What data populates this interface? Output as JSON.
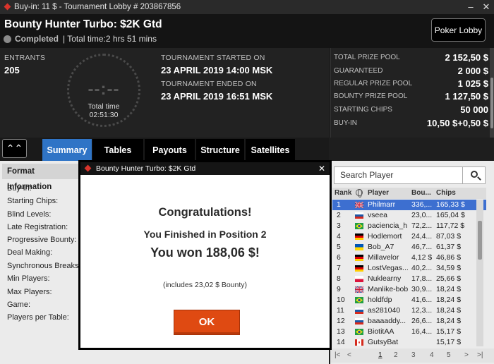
{
  "titlebar": {
    "title": "Buy-in: 11 $ - Tournament Lobby # 203867856",
    "minimize": "–",
    "close": "✕"
  },
  "header": {
    "name": "Bounty Hunter Turbo: $2K Gtd",
    "status": "Completed",
    "total_time": "| Total time:2 hrs  51 mins",
    "lobby_button": "Poker Lobby"
  },
  "info": {
    "entrants_label": "ENTRANTS",
    "entrants_value": "205",
    "clock_digits": "--:--",
    "clock_label": "Total time",
    "clock_time": "02:51:30",
    "started_label": "TOURNAMENT STARTED ON",
    "started_value": "23 APRIL 2019  14:00 MSK",
    "ended_label": "TOURNAMENT ENDED ON",
    "ended_value": "23 APRIL 2019  16:51 MSK"
  },
  "prize": [
    {
      "label": "TOTAL PRIZE POOL",
      "value": "2 152,50 $"
    },
    {
      "label": "GUARANTEED",
      "value": "2 000 $"
    },
    {
      "label": "REGULAR PRIZE POOL",
      "value": "1 025 $"
    },
    {
      "label": "BOUNTY PRIZE POOL",
      "value": "1 127,50 $"
    },
    {
      "label": "STARTING CHIPS",
      "value": "50 000"
    },
    {
      "label": "BUY-IN",
      "value": "10,50 $+0,50 $"
    }
  ],
  "tabs": {
    "collapse": "⌃⌃",
    "items": [
      "Summary",
      "Tables",
      "Payouts",
      "Structure",
      "Satellites"
    ]
  },
  "format": {
    "heading": "Format Information",
    "rows": [
      "Buy-In:",
      "Starting Chips:",
      "Blind Levels:",
      "Late Registration:",
      "Progressive Bounty:",
      "Deal Making:",
      "Synchronous Breaks:",
      "Min Players:",
      "Max Players:",
      "Game:",
      "Players per Table:"
    ]
  },
  "players": {
    "search_placeholder": "Search Player",
    "headers": {
      "rank": "Rank",
      "player": "Player",
      "bounty": "Bou...",
      "chips": "Chips"
    },
    "rows": [
      {
        "rank": "1",
        "name": "Philmarr",
        "bounty": "336,...",
        "chips": "165,33 $",
        "flag": "gb"
      },
      {
        "rank": "2",
        "name": "vseea",
        "bounty": "23,0...",
        "chips": "165,04 $",
        "flag": "ru"
      },
      {
        "rank": "3",
        "name": "paciencia_h",
        "bounty": "72,2...",
        "chips": "117,72 $",
        "flag": "br"
      },
      {
        "rank": "4",
        "name": "Hodlemort",
        "bounty": "24,4...",
        "chips": "87,03 $",
        "flag": "de"
      },
      {
        "rank": "5",
        "name": "Bob_A7",
        "bounty": "46,7...",
        "chips": "61,37 $",
        "flag": "ua"
      },
      {
        "rank": "6",
        "name": "Millavelor",
        "bounty": "4,12 $",
        "chips": "46,86 $",
        "flag": "de"
      },
      {
        "rank": "7",
        "name": "LostVegas...",
        "bounty": "40,2...",
        "chips": "34,59 $",
        "flag": "de"
      },
      {
        "rank": "8",
        "name": "Nuklearny",
        "bounty": "17,8...",
        "chips": "25,66 $",
        "flag": "pl"
      },
      {
        "rank": "9",
        "name": "Manlike-bob",
        "bounty": "30,9...",
        "chips": "18,24 $",
        "flag": "gb"
      },
      {
        "rank": "10",
        "name": "holdfdp",
        "bounty": "41,6...",
        "chips": "18,24 $",
        "flag": "br"
      },
      {
        "rank": "11",
        "name": "as281040",
        "bounty": "12,3...",
        "chips": "18,24 $",
        "flag": "ru"
      },
      {
        "rank": "12",
        "name": "baaaaddy...",
        "bounty": "26,6...",
        "chips": "18,24 $",
        "flag": "ru"
      },
      {
        "rank": "13",
        "name": "BiotitAA",
        "bounty": "16,4...",
        "chips": "15,17 $",
        "flag": "br"
      },
      {
        "rank": "14",
        "name": "GutsyBat",
        "bounty": "",
        "chips": "15,17 $",
        "flag": "ca"
      }
    ],
    "pager": {
      "first": "|<",
      "prev": "<",
      "pages": [
        "1",
        "2",
        "3",
        "4",
        "5"
      ],
      "next": ">",
      "last": ">|"
    }
  },
  "modal": {
    "title": "Bounty Hunter Turbo: $2K Gtd",
    "close": "✕",
    "congrats": "Congratulations!",
    "position": "You Finished in Position 2",
    "won": "You won 188,06 $!",
    "includes": "(includes 23,02 $ Bounty)",
    "ok": "OK"
  },
  "colors": {
    "accent": "#2f74c6",
    "ok_button": "#df4a12",
    "selected_row": "#3d6fd0"
  }
}
